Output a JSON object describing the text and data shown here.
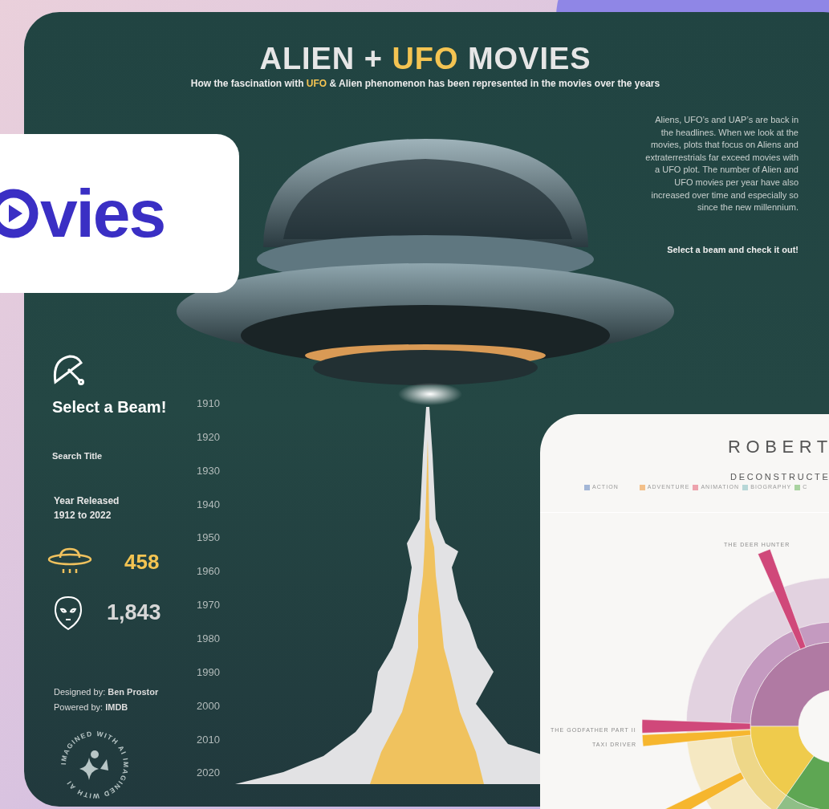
{
  "logo_card": {
    "text": "vies"
  },
  "dashboard": {
    "title_parts": [
      {
        "text": "ALIEN + ",
        "highlight": false
      },
      {
        "text": "UFO",
        "highlight": true
      },
      {
        "text": " MOVIES",
        "highlight": false
      }
    ],
    "subtitle_parts": [
      {
        "text": "How the fascination with ",
        "highlight": false
      },
      {
        "text": "UFO",
        "highlight": true
      },
      {
        "text": " & Alien phenomenon has been represented in the movies over the years",
        "highlight": false
      }
    ],
    "intro": "Aliens, UFO’s and UAP’s are back in the headlines. When we look at the movies, plots that focus on Aliens and extraterrestrials far exceed movies with a UFO plot. The number of Alien and UFO movies per year have also increased over time and especially so since the new millennium.",
    "call_to_action": "Select a beam and check it out!",
    "panel": {
      "heading": "Select a Beam!",
      "search_label": "Search Title",
      "year_label": "Year Released",
      "year_range": "1912 to 2022",
      "counts": [
        {
          "kind": "ufo",
          "value": "458"
        },
        {
          "kind": "alien",
          "value": "1,843"
        }
      ],
      "credits": [
        {
          "label": "Designed by: ",
          "name": "Ben Prostor"
        },
        {
          "label": "Powered by: ",
          "name": "IMDB"
        }
      ],
      "badge": "IMAGINED WITH AI IMAGINED WITH AI"
    },
    "year_axis": [
      "1910",
      "1920",
      "1930",
      "1940",
      "1950",
      "1960",
      "1970",
      "1980",
      "1990",
      "2000",
      "2010",
      "2020"
    ]
  },
  "sunburst_card": {
    "title": "ROBERT",
    "subtitle": "DECONSTRUCTE",
    "legend": [
      {
        "label": "ACTION",
        "color": "#a3b6d6"
      },
      {
        "label": "ADVENTURE",
        "color": "#f3c08a"
      },
      {
        "label": "ANIMATION",
        "color": "#eda3ad"
      },
      {
        "label": "BIOGRAPHY",
        "color": "#b7d7d7"
      },
      {
        "label": "C",
        "color": "#a9d3a0"
      }
    ],
    "labels": [
      {
        "text": "THE DEER HUNTER"
      },
      {
        "text": "THE GODFATHER PART II"
      },
      {
        "text": "TAXI DRIVER"
      }
    ]
  }
}
